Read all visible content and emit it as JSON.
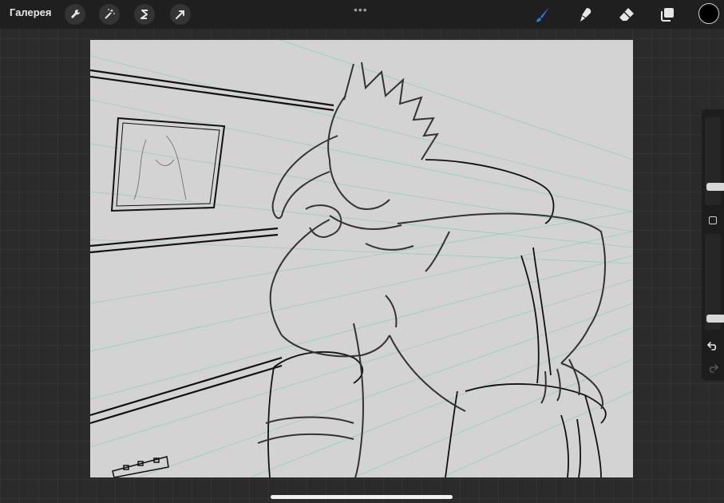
{
  "topbar": {
    "gallery_label": "Галерея",
    "left_tools": [
      "wrench-icon",
      "magic-wand-icon",
      "selection-s-icon",
      "transform-arrow-icon"
    ],
    "more_glyph": "•••",
    "right_tools": [
      "brush-icon",
      "smudge-icon",
      "eraser-icon",
      "layers-icon"
    ],
    "active_tool": "brush-icon",
    "accent_color": "#1f7fe0",
    "current_color": "#000000"
  },
  "sidebar": {
    "brush_size_level": 0.18,
    "opacity_level": 0.08,
    "icons": [
      "undo-icon",
      "redo-icon"
    ]
  }
}
